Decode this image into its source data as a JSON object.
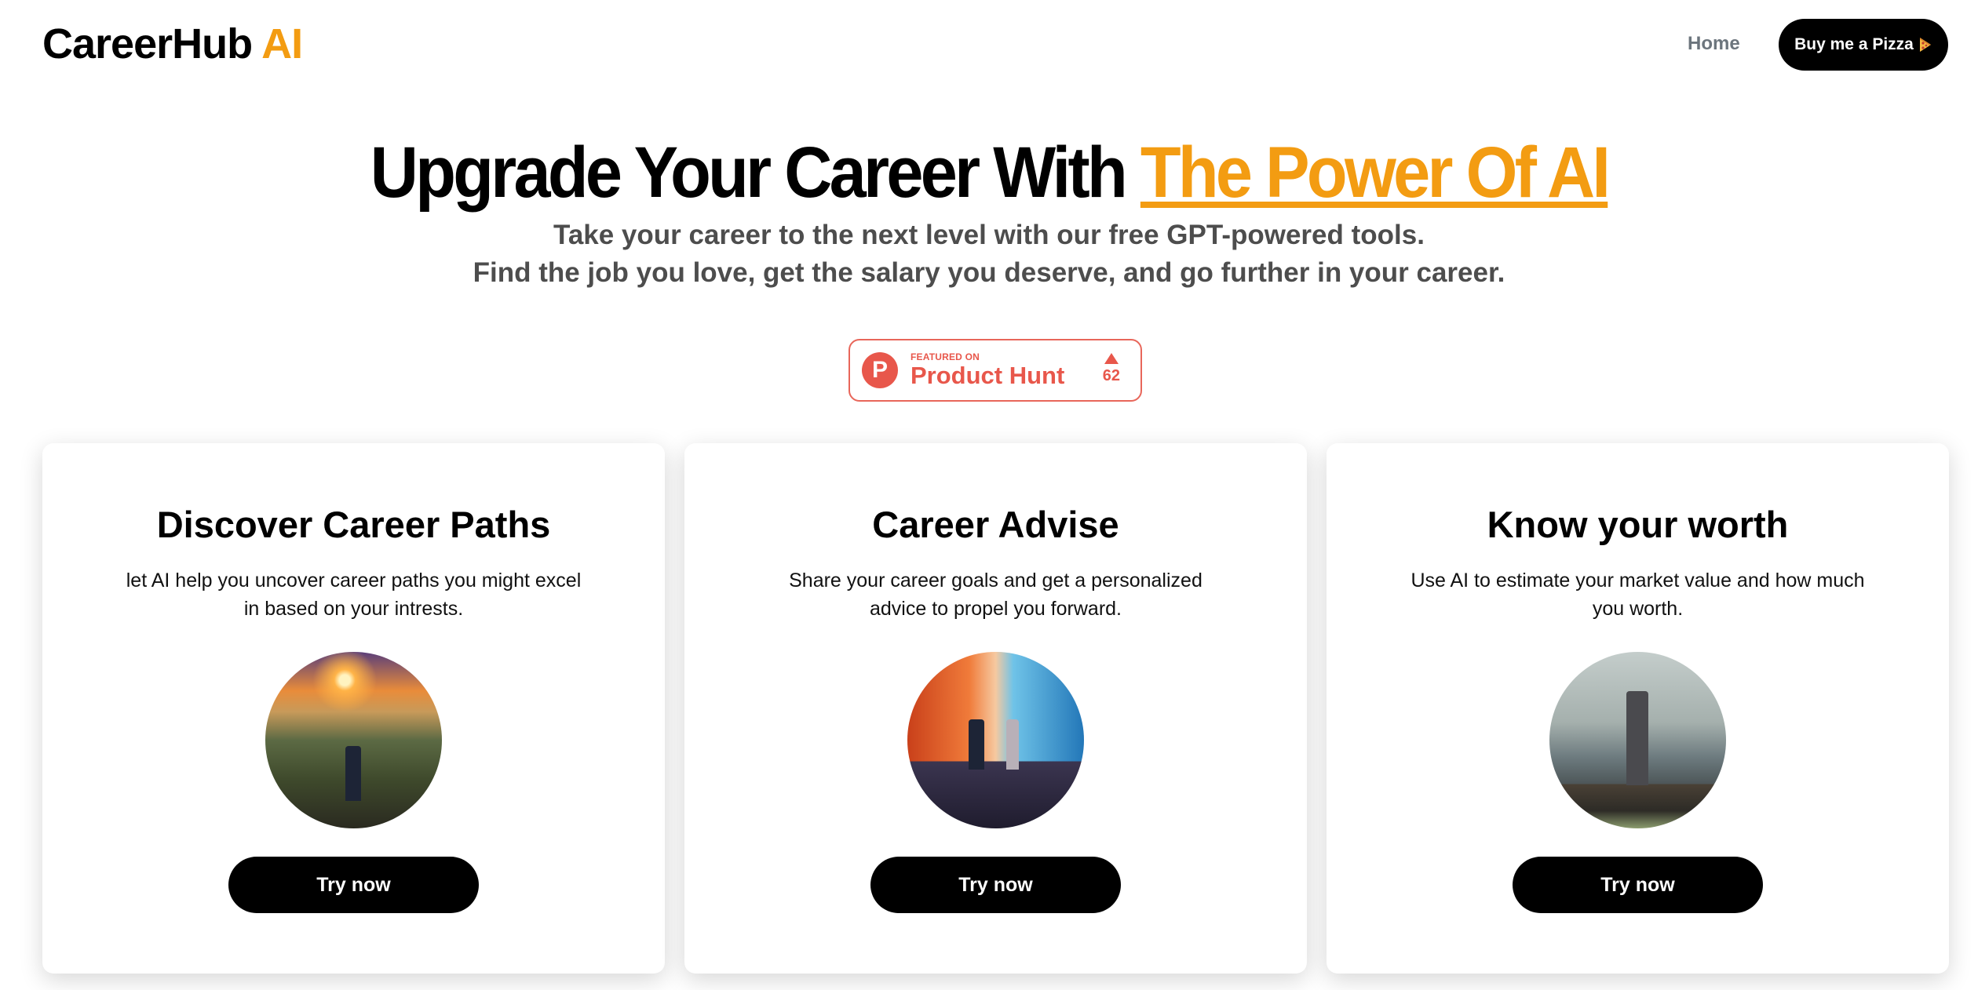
{
  "header": {
    "logo_main": "CareerHub",
    "logo_accent": "AI",
    "nav_home": "Home",
    "pizza_button": "Buy me a Pizza",
    "pizza_icon": "pizza-slice-icon"
  },
  "hero": {
    "title_main": "Upgrade Your Career With ",
    "title_accent": "The Power Of AI",
    "subtitle_line1": "Take your career to the next level with our free GPT-powered tools.",
    "subtitle_line2": "Find the job you love, get the salary you deserve, and go further in your career."
  },
  "product_hunt": {
    "logo_letter": "P",
    "featured_label": "FEATURED ON",
    "name": "Product Hunt",
    "votes": "62"
  },
  "colors": {
    "accent": "#f39c12",
    "product_hunt": "#e8574b",
    "button": "#000000"
  },
  "cards": [
    {
      "title": "Discover Career Paths",
      "description": "let AI help you uncover career paths you might excel in based on your intrests.",
      "image_alt": "person at a fork in the road facing a city skyline at sunset",
      "button": "Try now"
    },
    {
      "title": "Career Advise",
      "description": "Share your career goals and get a personalized advice to propel you forward.",
      "image_alt": "person and robot standing at top of stairs before a glowing orange and blue wall",
      "button": "Try now"
    },
    {
      "title": "Know your worth",
      "description": "Use AI to estimate your market value and how much you worth.",
      "image_alt": "businessman walking on rail tracks with money in front of a city skyline",
      "button": "Try now"
    }
  ]
}
